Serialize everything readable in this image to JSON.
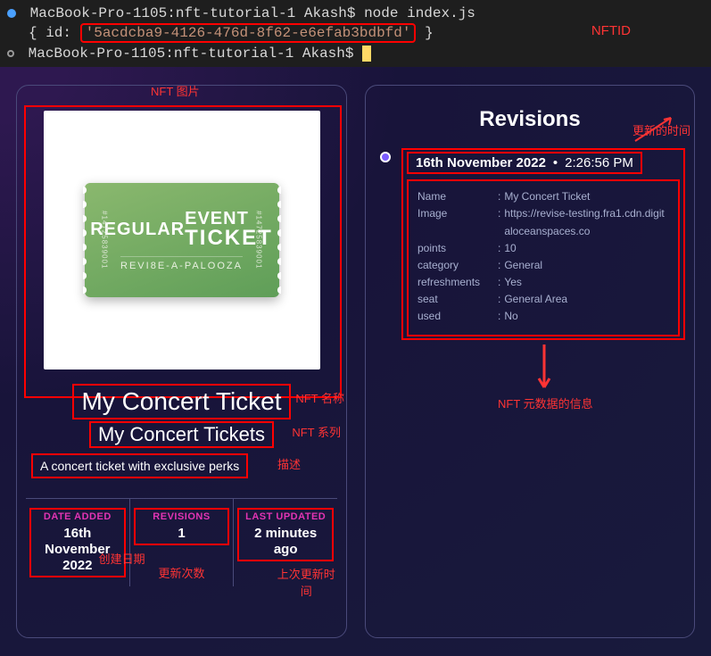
{
  "terminal": {
    "line1_prompt": "MacBook-Pro-1105:nft-tutorial-1 Akash$",
    "line1_cmd": "node index.js",
    "line2_prefix": "{ id:",
    "line2_id": "'5acdcba9-4126-476d-8f62-e6efab3bdbfd'",
    "line2_suffix": " }",
    "nftid_label": "NFTID",
    "line3_prompt": "MacBook-Pro-1105:nft-tutorial-1 Akash$"
  },
  "annotations": {
    "nft_image": "NFT 图片",
    "nft_name": "NFT 名称",
    "nft_series": "NFT 系列",
    "description": "描述",
    "date_added": "创建日期",
    "revisions_count": "更新次数",
    "last_updated": "上次更新时间",
    "updated_time": "更新的时间",
    "metadata_info": "NFT 元数据的信息"
  },
  "ticket": {
    "regular": "REGULAR",
    "event": "EVENT",
    "ticket_word": "TICKET",
    "subtitle": "REVI8E-A-PALOOZA",
    "serial": "#14725839001"
  },
  "nft": {
    "name": "My Concert Ticket",
    "series": "My Concert Tickets",
    "description": "A concert ticket with exclusive perks"
  },
  "stats": {
    "date_added_label": "DATE ADDED",
    "date_added_value": "16th November 2022",
    "revisions_label": "REVISIONS",
    "revisions_value": "1",
    "last_updated_label": "LAST UPDATED",
    "last_updated_value": "2 minutes ago"
  },
  "revisions": {
    "title": "Revisions",
    "entry_date": "16th November 2022",
    "entry_time_sep": " • ",
    "entry_time": "2:26:56 PM",
    "fields": [
      {
        "key": "Name",
        "value": "My Concert Ticket"
      },
      {
        "key": "Image",
        "value": "https://revise-testing.fra1.cdn.digitaloceanspaces.co"
      },
      {
        "key": "points",
        "value": "10"
      },
      {
        "key": "category",
        "value": "General"
      },
      {
        "key": "refreshments",
        "value": "Yes"
      },
      {
        "key": "seat",
        "value": "General Area"
      },
      {
        "key": "used",
        "value": "No"
      }
    ]
  }
}
